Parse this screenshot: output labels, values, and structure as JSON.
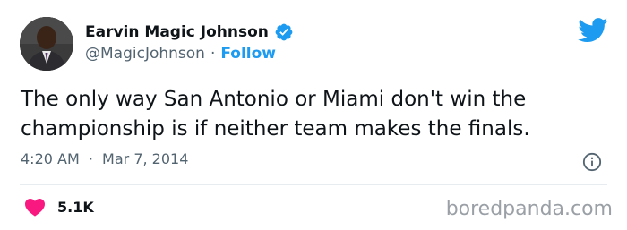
{
  "author": {
    "display_name": "Earvin Magic Johnson",
    "handle": "@MagicJohnson",
    "separator": "·",
    "follow_label": "Follow",
    "verified": true,
    "avatar_icon": "avatar-photo"
  },
  "tweet": {
    "text": "The only way San Antonio or Miami don't win the championship is if neither team makes the finals.",
    "time": "4:20 AM",
    "separator": "·",
    "date": "Mar 7, 2014"
  },
  "engagement": {
    "likes": "5.1K"
  },
  "icons": {
    "brand": "twitter-bird-icon",
    "info": "info-icon",
    "like": "heart-icon",
    "verified": "verified-badge-icon"
  },
  "colors": {
    "accent": "#1d9bf0",
    "heart": "#f91880",
    "text": "#0f1419",
    "muted": "#536471"
  },
  "watermark": "boredpanda.com"
}
